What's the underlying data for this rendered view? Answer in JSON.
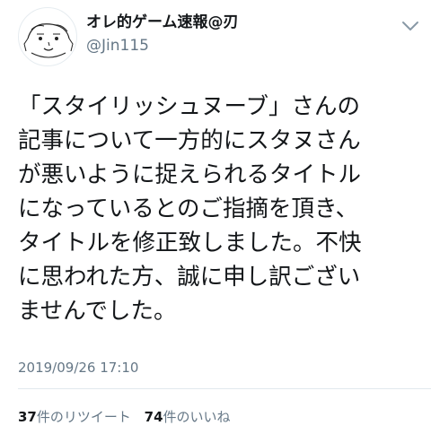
{
  "author": {
    "display_name": "オレ的ゲーム速報@刃",
    "handle": "@Jin115",
    "avatar_icon": "face-drawing-icon",
    "menu_icon": "chevron-down-icon"
  },
  "tweet": {
    "text_lines": [
      "「スタイリッシュヌーブ」さんの",
      "記事について一方的にスタヌさん",
      "が悪いように捉えられるタイトル",
      "になっているとのご指摘を頂き、",
      "タイトルを修正致しました。不快",
      "に思われた方、誠に申し訳ござい",
      "ませんでした。"
    ],
    "timestamp": "2019/09/26 17:10"
  },
  "stats": {
    "retweet_count": "37",
    "retweet_label": "件のリツイート",
    "like_count": "74",
    "like_label": "件のいいね"
  },
  "colors": {
    "text": "#14171a",
    "secondary": "#657786",
    "divider": "#e1e8ed"
  }
}
